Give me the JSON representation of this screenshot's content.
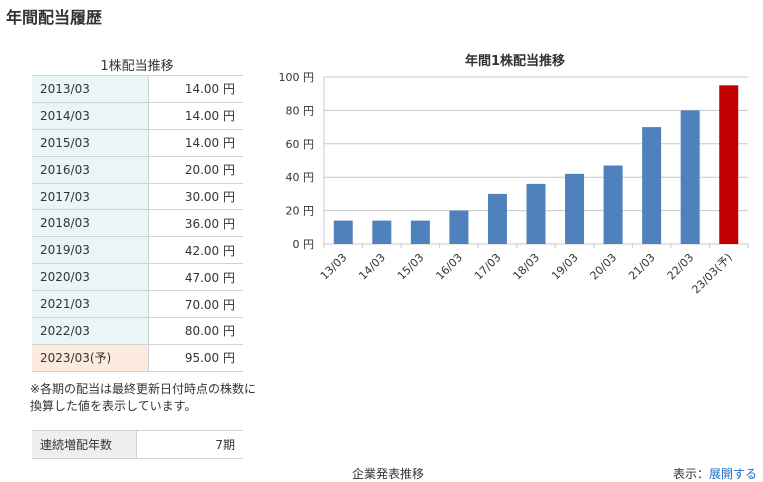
{
  "page": {
    "title": "年間配当履歴"
  },
  "dividend_table": {
    "caption": "1株配当推移",
    "rows": [
      {
        "period": "2013/03",
        "value": "14.00 円"
      },
      {
        "period": "2014/03",
        "value": "14.00 円"
      },
      {
        "period": "2015/03",
        "value": "14.00 円"
      },
      {
        "period": "2016/03",
        "value": "20.00 円"
      },
      {
        "period": "2017/03",
        "value": "30.00 円"
      },
      {
        "period": "2018/03",
        "value": "36.00 円"
      },
      {
        "period": "2019/03",
        "value": "42.00 円"
      },
      {
        "period": "2020/03",
        "value": "47.00 円"
      },
      {
        "period": "2021/03",
        "value": "70.00 円"
      },
      {
        "period": "2022/03",
        "value": "80.00 円"
      },
      {
        "period": "2023/03(予)",
        "value": "95.00 円"
      }
    ],
    "note": "※各期の配当は最終更新日付時点の株数に換算した値を表示しています。"
  },
  "streak": {
    "label": "連続増配年数",
    "value": "7期"
  },
  "colors": {
    "bar": "#4f81bd",
    "forecast_bar": "#c00000",
    "year_cell": "#eaf5f6",
    "forecast_cell": "#fdeadf"
  },
  "chart_data": {
    "type": "bar",
    "title": "年間1株配当推移",
    "categories": [
      "13/03",
      "14/03",
      "15/03",
      "16/03",
      "17/03",
      "18/03",
      "19/03",
      "20/03",
      "21/03",
      "22/03",
      "23/03(予)"
    ],
    "values": [
      14,
      14,
      14,
      20,
      30,
      36,
      42,
      47,
      70,
      80,
      95
    ],
    "forecast_index": 10,
    "ylim": [
      0,
      100
    ],
    "yticks": [
      0,
      20,
      40,
      60,
      80,
      100
    ],
    "ytick_labels": [
      "0 円",
      "20 円",
      "40 円",
      "60 円",
      "80 円",
      "100 円"
    ],
    "grid": true,
    "legend": "none"
  },
  "bottom": {
    "left_cut": "企業発表推移",
    "right_cut": "表示：",
    "right_link": "展開する"
  }
}
